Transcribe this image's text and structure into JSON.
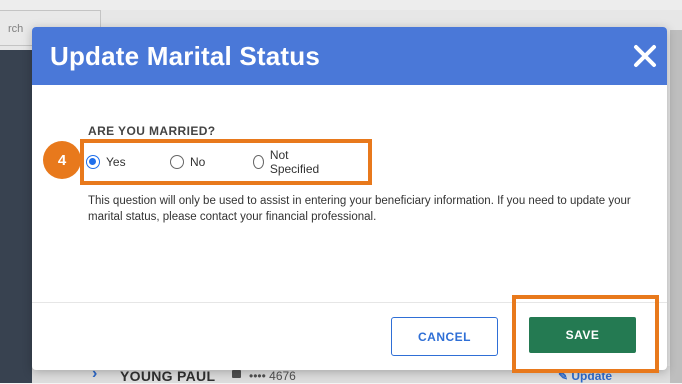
{
  "background": {
    "search_placeholder": "rch",
    "row": {
      "name": "YOUNG PAUL",
      "account": "•••• 4676",
      "update_label": "Update"
    }
  },
  "modal": {
    "title": "Update Marital Status",
    "close_icon": "close-icon",
    "question": "ARE YOU MARRIED?",
    "options": [
      {
        "label": "Yes",
        "checked": true
      },
      {
        "label": "No",
        "checked": false
      },
      {
        "label": "Not Specified",
        "checked": false
      }
    ],
    "help_text": "This question will only be used to assist in entering your beneficiary information. If you need to update your marital status, please contact your financial professional.",
    "cancel_label": "CANCEL",
    "save_label": "SAVE"
  },
  "annotation": {
    "step_number": "4",
    "highlight_color": "#e8791c"
  },
  "colors": {
    "header": "#4a78d8",
    "primary": "#2f6fd6",
    "save": "#247a52"
  }
}
